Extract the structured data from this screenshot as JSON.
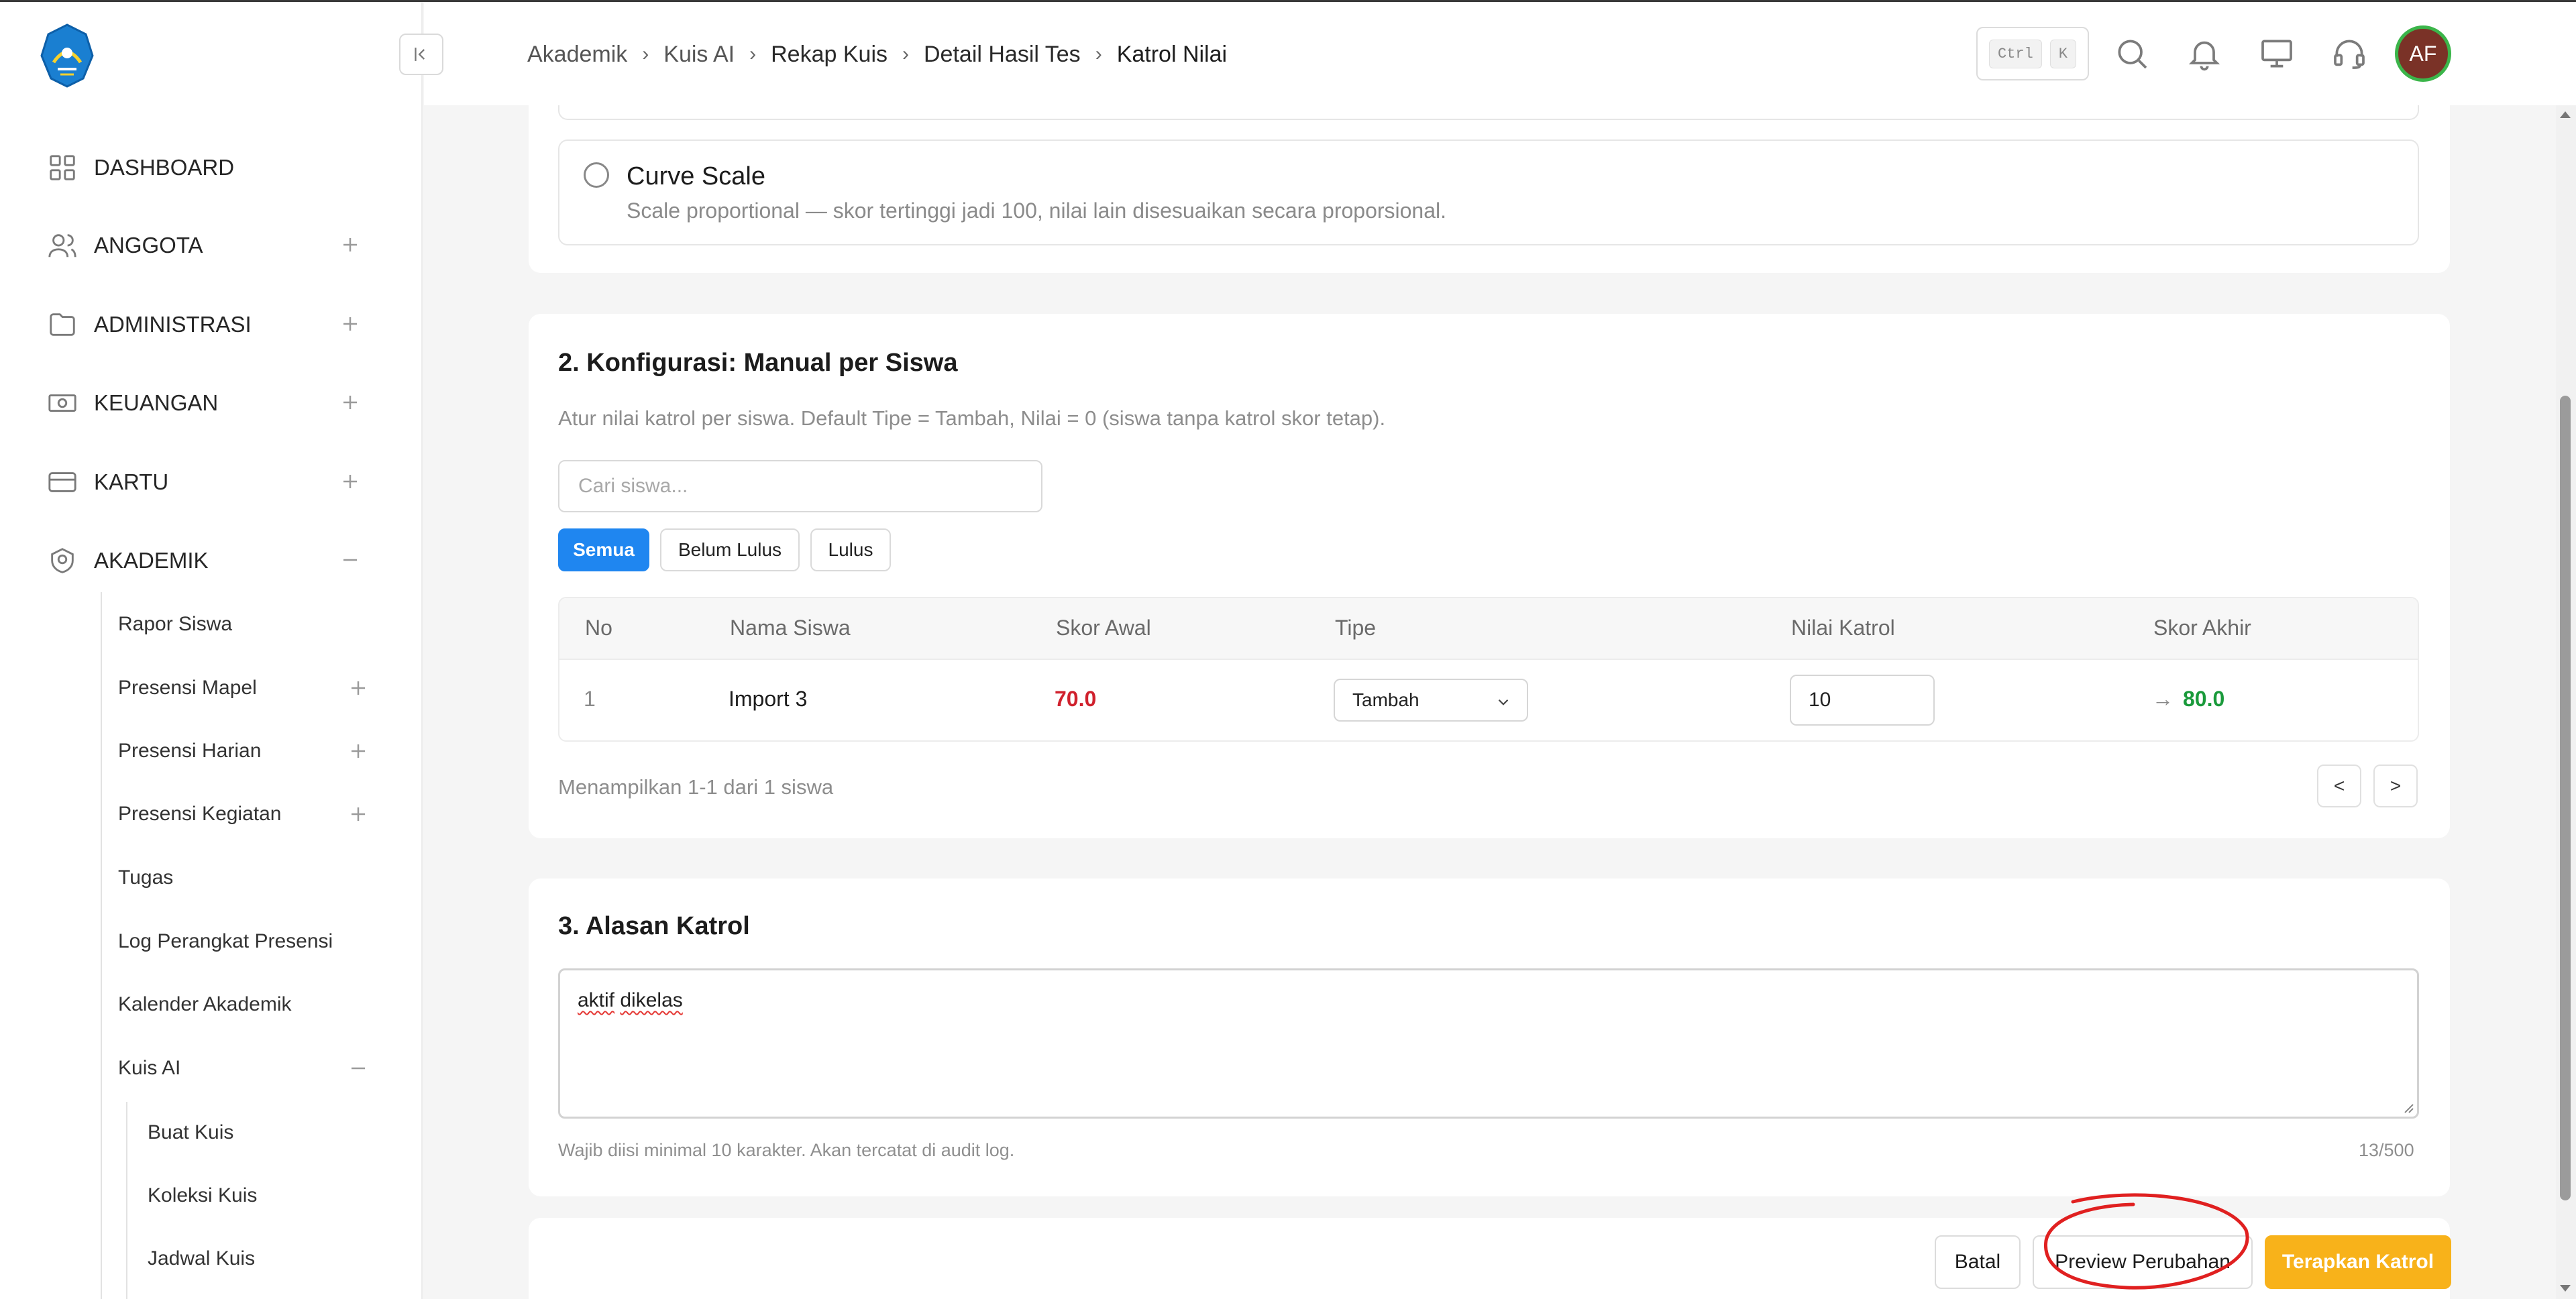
{
  "breadcrumb": [
    "Akademik",
    "Kuis AI",
    "Rekap Kuis",
    "Detail Hasil Tes",
    "Katrol Nilai"
  ],
  "header": {
    "kbd_ctrl": "Ctrl",
    "kbd_k": "K",
    "avatar_initials": "AF",
    "icons": [
      "search-icon",
      "bell-icon",
      "monitor-icon",
      "headset-icon"
    ]
  },
  "sidebar": {
    "items": [
      {
        "label": "DASHBOARD",
        "icon": "grid-icon"
      },
      {
        "label": "ANGGOTA",
        "icon": "users-icon"
      },
      {
        "label": "ADMINISTRASI",
        "icon": "folder-icon"
      },
      {
        "label": "KEUANGAN",
        "icon": "cash-icon"
      },
      {
        "label": "KARTU",
        "icon": "card-icon"
      },
      {
        "label": "AKADEMIK",
        "icon": "academic-icon"
      }
    ],
    "akademik_sub": [
      "Rapor Siswa",
      "Presensi Mapel",
      "Presensi Harian",
      "Presensi Kegiatan",
      "Tugas",
      "Log Perangkat Presensi",
      "Kalender Akademik",
      "Kuis AI"
    ],
    "kuis_sub": [
      "Buat Kuis",
      "Koleksi Kuis",
      "Jadwal Kuis"
    ]
  },
  "curve": {
    "title": "Curve Scale",
    "desc": "Scale proportional — skor tertinggi jadi 100, nilai lain disesuaikan secara proporsional."
  },
  "config": {
    "title": "2. Konfigurasi: Manual per Siswa",
    "desc": "Atur nilai katrol per siswa. Default Tipe = Tambah, Nilai = 0 (siswa tanpa katrol skor tetap).",
    "search_placeholder": "Cari siswa...",
    "filters": [
      "Semua",
      "Belum Lulus",
      "Lulus"
    ],
    "columns": [
      "No",
      "Nama Siswa",
      "Skor Awal",
      "Tipe",
      "Nilai Katrol",
      "Skor Akhir"
    ],
    "rows": [
      {
        "no": "1",
        "name": "Import 3",
        "skor_awal": "70.0",
        "tipe": "Tambah",
        "nilai_katrol": "10",
        "arrow": "→",
        "skor_akhir": "80.0"
      }
    ],
    "pagination_text": "Menampilkan 1-1 dari 1 siswa",
    "prev": "<",
    "next": ">"
  },
  "alasan": {
    "title": "3. Alasan Katrol",
    "value_word1": "aktif",
    "value_word2": "dikelas",
    "hint": "Wajib diisi minimal 10 karakter. Akan tercatat di audit log.",
    "count": "13/500"
  },
  "actions": {
    "batal": "Batal",
    "preview": "Preview Perubahan",
    "terapkan": "Terapkan Katrol"
  },
  "colors": {
    "accent": "#1f86f0",
    "primary_action": "#f8b21a",
    "score_red": "#d0212d",
    "score_green": "#1a9a3b",
    "highlight_circle": "#e02020"
  }
}
